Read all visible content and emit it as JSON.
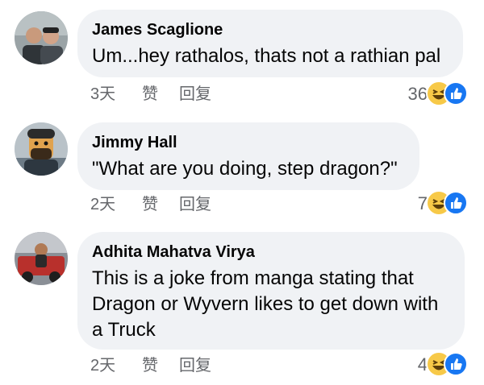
{
  "comments": [
    {
      "author": "James Scaglione",
      "lines": [
        "Um...hey rathalos, thats not a rathian pal"
      ],
      "time": "3天",
      "like_label": "赞",
      "reply_label": "回复",
      "reaction_count": "36",
      "reaction_icons": [
        "haha-icon",
        "like-icon"
      ]
    },
    {
      "author": "Jimmy Hall",
      "lines": [
        "\"What are you doing, step dragon?\""
      ],
      "time": "2天",
      "like_label": "赞",
      "reply_label": "回复",
      "reaction_count": "7",
      "reaction_icons": [
        "haha-icon",
        "like-icon"
      ]
    },
    {
      "author": "Adhita Mahatva Virya",
      "lines": [
        "This is a joke from manga stating that",
        "Dragon or Wyvern likes to get down with",
        "a Truck"
      ],
      "time": "2天",
      "like_label": "赞",
      "reply_label": "回复",
      "reaction_count": "4",
      "reaction_icons": [
        "haha-icon",
        "like-icon"
      ]
    }
  ],
  "colors": {
    "bubble": "#f0f2f5",
    "meta_text": "#65676b",
    "like_blue": "#1877f2",
    "haha_yellow": "#f7c948"
  }
}
